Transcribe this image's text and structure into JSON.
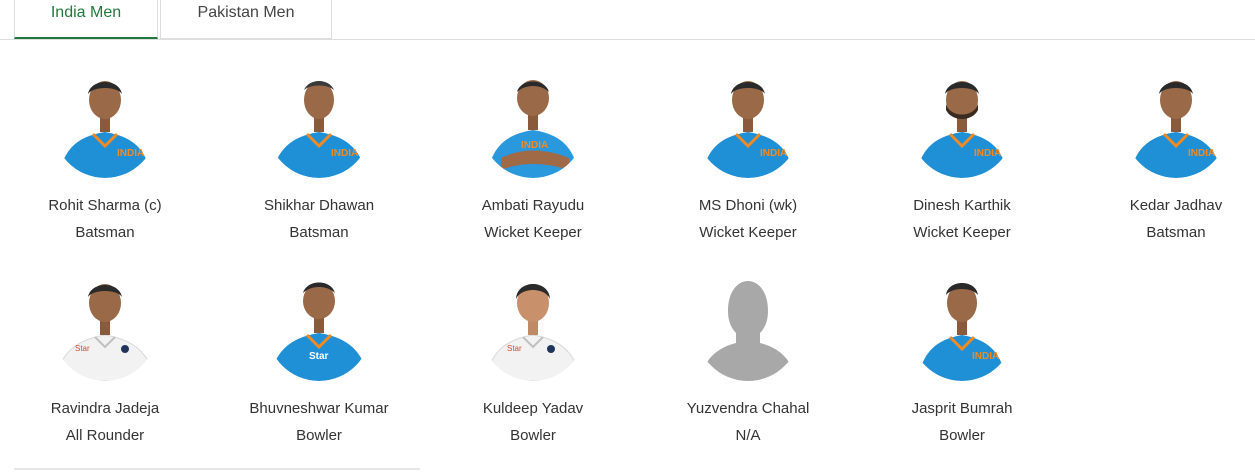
{
  "tabs": [
    {
      "label": "India Men",
      "active": true
    },
    {
      "label": "Pakistan Men",
      "active": false
    }
  ],
  "colors": {
    "accent": "#1f7a3c",
    "jersey_blue": "#1f8fd6",
    "test_white": "#f2f2f2",
    "placeholder_gray": "#a8a8a8"
  },
  "players": [
    {
      "name": "Rohit Sharma (c)",
      "role": "Batsman",
      "avatar": "jersey-blue-photo"
    },
    {
      "name": "Shikhar Dhawan",
      "role": "Batsman",
      "avatar": "jersey-blue-photo"
    },
    {
      "name": "Ambati Rayudu",
      "role": "Wicket Keeper",
      "avatar": "jersey-blue-photo"
    },
    {
      "name": "MS Dhoni (wk)",
      "role": "Wicket Keeper",
      "avatar": "jersey-blue-photo"
    },
    {
      "name": "Dinesh Karthik",
      "role": "Wicket Keeper",
      "avatar": "jersey-blue-photo"
    },
    {
      "name": "Kedar Jadhav",
      "role": "Batsman",
      "avatar": "jersey-blue-photo"
    },
    {
      "name": "Ravindra Jadeja",
      "role": "All Rounder",
      "avatar": "white-jersey-photo"
    },
    {
      "name": "Bhuvneshwar Kumar",
      "role": "Bowler",
      "avatar": "jersey-blue-photo"
    },
    {
      "name": "Kuldeep Yadav",
      "role": "Bowler",
      "avatar": "white-jersey-photo"
    },
    {
      "name": "Yuzvendra Chahal",
      "role": "N/A",
      "avatar": "placeholder-silhouette"
    },
    {
      "name": "Jasprit Bumrah",
      "role": "Bowler",
      "avatar": "jersey-blue-photo"
    }
  ]
}
